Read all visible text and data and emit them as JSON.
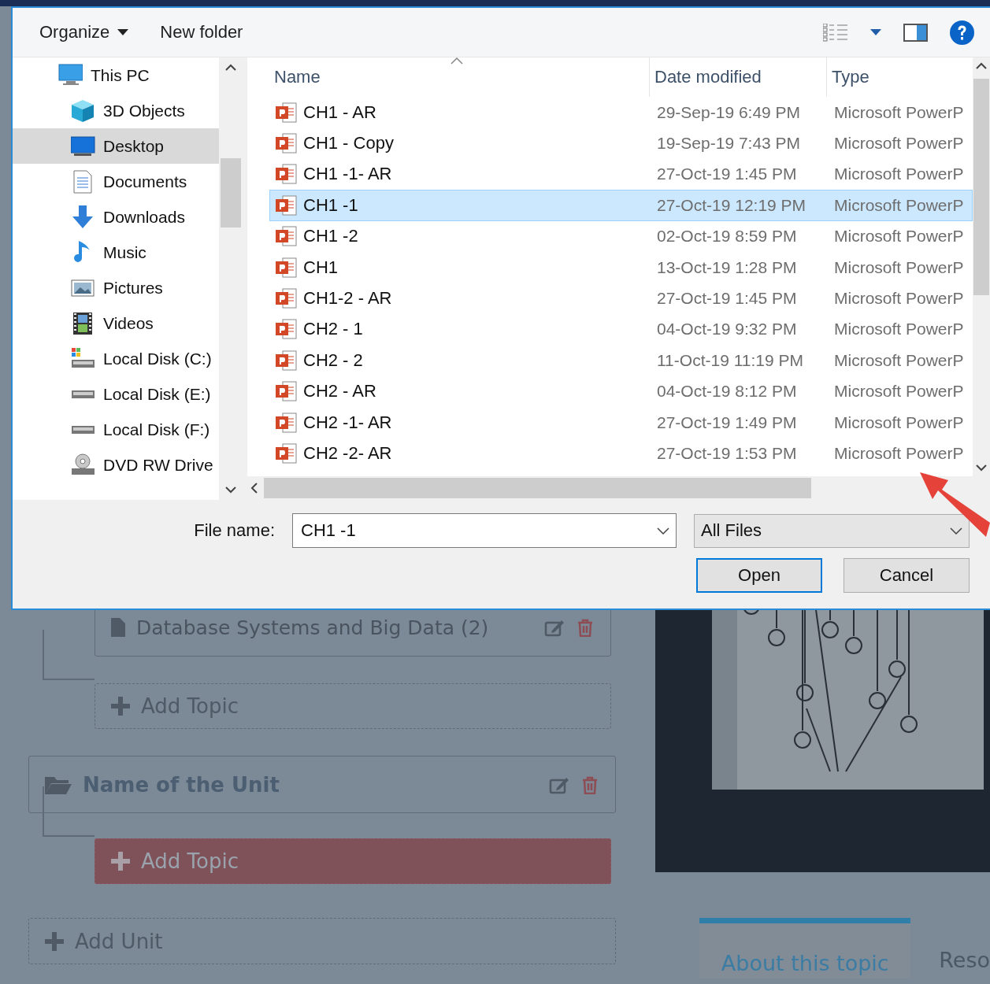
{
  "dialog": {
    "toolbar": {
      "organize": "Organize",
      "new_folder": "New folder"
    },
    "nav": {
      "items": [
        {
          "label": "This PC",
          "kind": "pc",
          "selected": false,
          "children": [
            {
              "label": "3D Objects",
              "kind": "cube",
              "selected": false
            },
            {
              "label": "Desktop",
              "kind": "desktop",
              "selected": true
            },
            {
              "label": "Documents",
              "kind": "doc",
              "selected": false
            },
            {
              "label": "Downloads",
              "kind": "down",
              "selected": false
            },
            {
              "label": "Music",
              "kind": "music",
              "selected": false
            },
            {
              "label": "Pictures",
              "kind": "pic",
              "selected": false
            },
            {
              "label": "Videos",
              "kind": "video",
              "selected": false
            },
            {
              "label": "Local Disk (C:)",
              "kind": "sysdisk",
              "selected": false
            },
            {
              "label": "Local Disk (E:)",
              "kind": "disk",
              "selected": false
            },
            {
              "label": "Local Disk (F:)",
              "kind": "disk",
              "selected": false
            },
            {
              "label": "DVD RW Drive",
              "kind": "dvd",
              "selected": false
            }
          ]
        }
      ]
    },
    "columns": [
      "Name",
      "Date modified",
      "Type"
    ],
    "files": [
      {
        "name": "CH1 - AR",
        "date": "29-Sep-19 6:49 PM",
        "type": "Microsoft PowerP",
        "selected": false
      },
      {
        "name": "CH1 - Copy",
        "date": "19-Sep-19 7:43 PM",
        "type": "Microsoft PowerP",
        "selected": false
      },
      {
        "name": "CH1 -1- AR",
        "date": "27-Oct-19 1:45 PM",
        "type": "Microsoft PowerP",
        "selected": false
      },
      {
        "name": "CH1 -1",
        "date": "27-Oct-19 12:19 PM",
        "type": "Microsoft PowerP",
        "selected": true
      },
      {
        "name": "CH1 -2",
        "date": "02-Oct-19 8:59 PM",
        "type": "Microsoft PowerP",
        "selected": false
      },
      {
        "name": "CH1",
        "date": "13-Oct-19 1:28 PM",
        "type": "Microsoft PowerP",
        "selected": false
      },
      {
        "name": "CH1-2 - AR",
        "date": "27-Oct-19 1:45 PM",
        "type": "Microsoft PowerP",
        "selected": false
      },
      {
        "name": "CH2 - 1",
        "date": "04-Oct-19 9:32 PM",
        "type": "Microsoft PowerP",
        "selected": false
      },
      {
        "name": "CH2 - 2",
        "date": "11-Oct-19 11:19 PM",
        "type": "Microsoft PowerP",
        "selected": false
      },
      {
        "name": "CH2 - AR",
        "date": "04-Oct-19 8:12 PM",
        "type": "Microsoft PowerP",
        "selected": false
      },
      {
        "name": "CH2 -1- AR",
        "date": "27-Oct-19 1:49 PM",
        "type": "Microsoft PowerP",
        "selected": false
      },
      {
        "name": "CH2 -2- AR",
        "date": "27-Oct-19 1:53 PM",
        "type": "Microsoft PowerP",
        "selected": false
      }
    ],
    "file_name_label": "File name:",
    "file_name": "CH1 -1",
    "filter": "All Files",
    "buttons": [
      "Open",
      "Cancel"
    ]
  },
  "page": {
    "tree": [
      {
        "kind": "topic",
        "label": "Database Systems and Big Data (2)"
      },
      {
        "kind": "add_topic",
        "label": "Add Topic"
      },
      {
        "kind": "unit",
        "label": "Name of the Unit"
      },
      {
        "kind": "add_topic_active",
        "label": "Add Topic"
      },
      {
        "kind": "add_unit",
        "label": "Add Unit"
      }
    ],
    "tabs": [
      {
        "label": "About this topic",
        "selected": true
      },
      {
        "label": "Reso",
        "selected": false
      }
    ]
  }
}
